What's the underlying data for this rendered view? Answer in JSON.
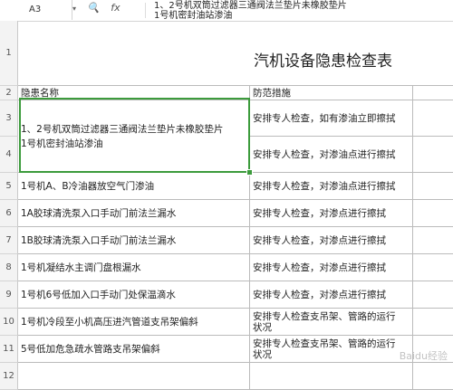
{
  "formula_bar": {
    "name_box": "A3",
    "icon_search": "🔍",
    "icon_fx": "fx",
    "formula_line1": "1、2号机双筒过滤器三通阀法兰垫片未橡胶垫片",
    "formula_line2": "1号机密封油站渗油"
  },
  "sheet": {
    "title": "汽机设备隐患检查表",
    "header_name": "隐患名称",
    "header_measure": "防范措施",
    "rows": [
      {
        "num": "3",
        "name": "1、2号机双筒过滤器三通阀法兰垫片未橡胶垫片",
        "measure": "安排专人检查，如有渗油立即擦拭"
      },
      {
        "num": "4",
        "name": "1号机密封油站渗油",
        "measure": "安排专人检查，对渗油点进行擦拭"
      },
      {
        "num": "5",
        "name": "1号机A、B冷油器放空气门渗油",
        "measure": "安排专人检查，对渗油点进行擦拭"
      },
      {
        "num": "6",
        "name": "1A胶球清洗泵入口手动门前法兰漏水",
        "measure": "安排专人检查，对渗点进行擦拭"
      },
      {
        "num": "7",
        "name": "1B胶球清洗泵入口手动门前法兰漏水",
        "measure": "安排专人检查，对渗点进行擦拭"
      },
      {
        "num": "8",
        "name": "1号机凝结水主调门盘根漏水",
        "measure": "安排专人检查，对渗点进行擦拭"
      },
      {
        "num": "9",
        "name": "1号机6号低加入口手动门处保温滴水",
        "measure": "安排专人检查，对渗点进行擦拭"
      },
      {
        "num": "10",
        "name": "1号机冷段至小机高压进汽管道支吊架偏斜",
        "measure_l1": "安排专人检查支吊架、管路的运行",
        "measure_l2": "状况"
      },
      {
        "num": "11",
        "name": "5号低加危急疏水管路支吊架偏斜",
        "measure_l1": "安排专人检查支吊架、管路的运行",
        "measure_l2": "状况"
      },
      {
        "num": "12",
        "name": "",
        "measure": ""
      }
    ],
    "row_numbers": [
      "1",
      "2"
    ],
    "watermark": "Baidu经验"
  }
}
